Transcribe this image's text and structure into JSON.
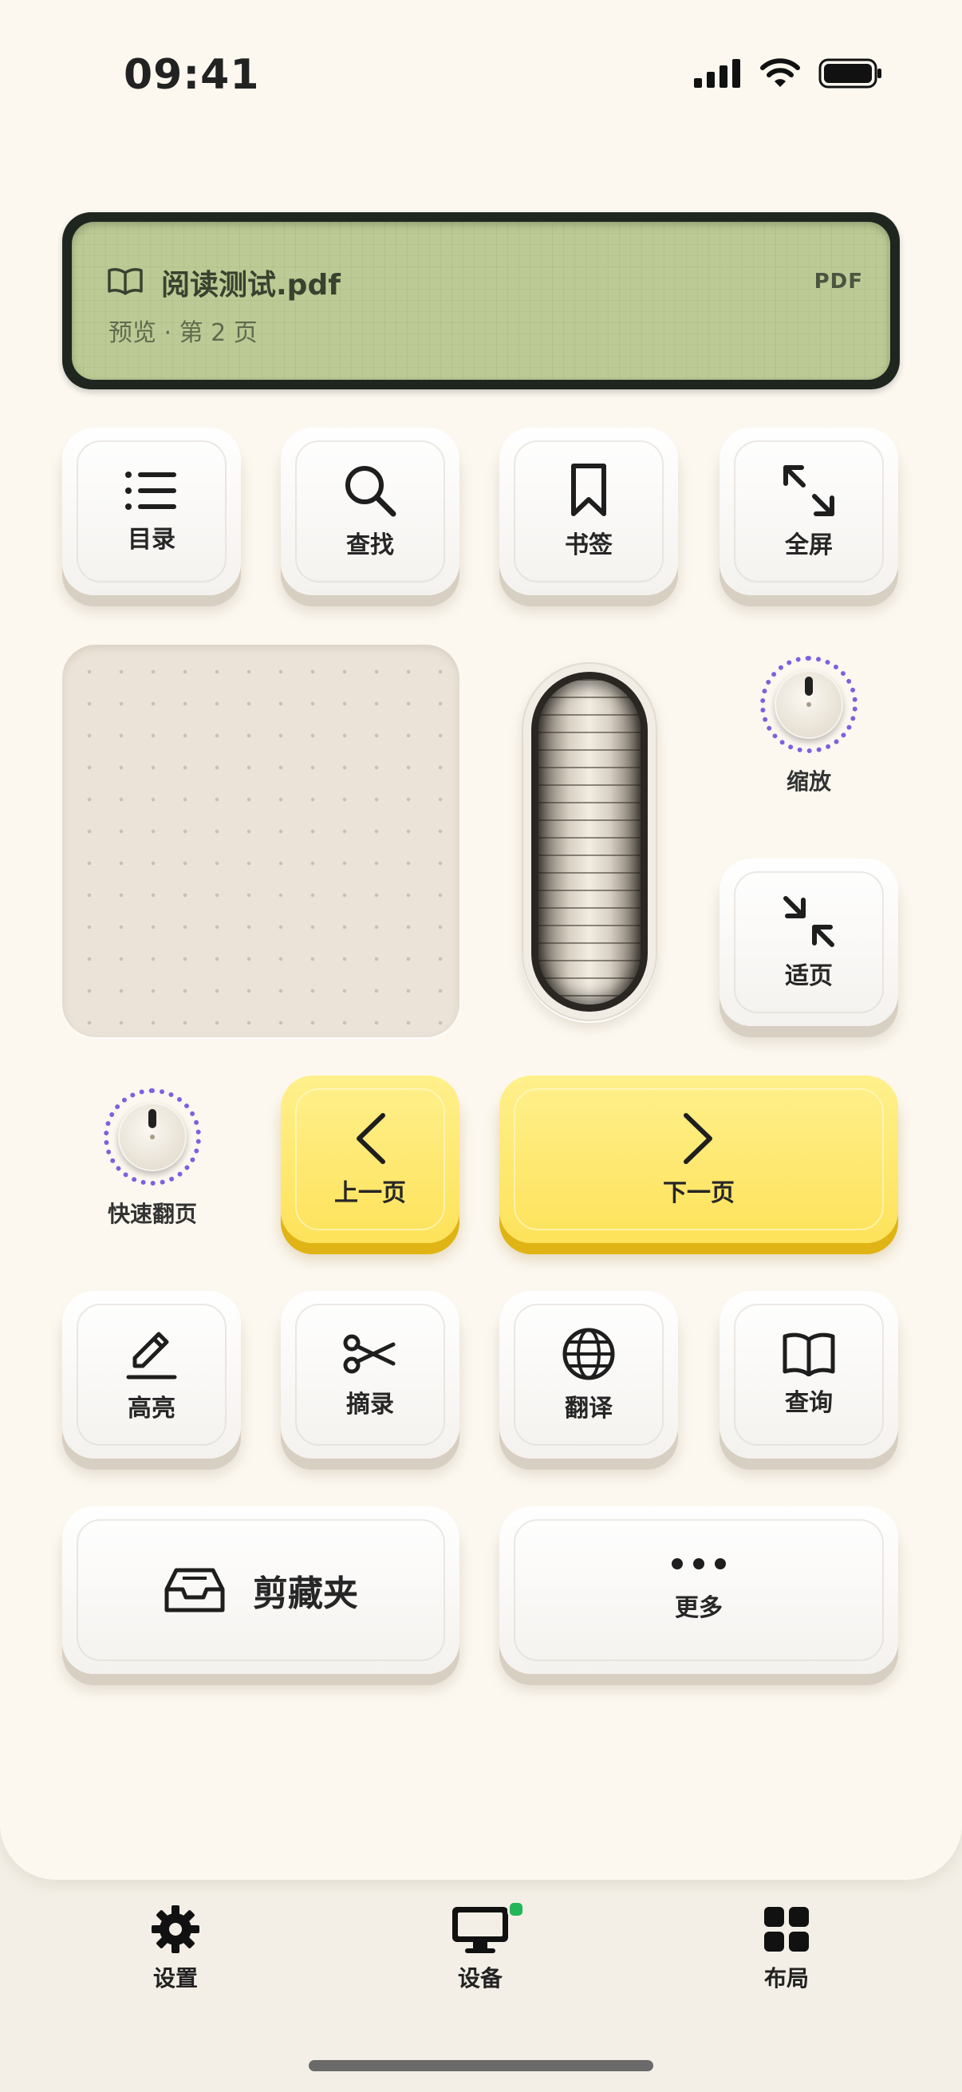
{
  "status": {
    "time": "09:41"
  },
  "display": {
    "title": "阅读测试.pdf",
    "subtitle": "预览 · 第 2 页",
    "badge": "PDF"
  },
  "top_keys": [
    {
      "label": "目录",
      "icon": "list-icon"
    },
    {
      "label": "查找",
      "icon": "search-icon"
    },
    {
      "label": "书签",
      "icon": "bookmark-icon"
    },
    {
      "label": "全屏",
      "icon": "expand-icon"
    }
  ],
  "zoom": {
    "label": "缩放"
  },
  "fit_page": {
    "label": "适页",
    "icon": "shrink-icon"
  },
  "quick_flip": {
    "label": "快速翻页"
  },
  "prev_page": {
    "label": "上一页",
    "icon": "chevron-left-icon"
  },
  "next_page": {
    "label": "下一页",
    "icon": "chevron-right-icon"
  },
  "tool_keys": [
    {
      "label": "高亮",
      "icon": "pencil-icon"
    },
    {
      "label": "摘录",
      "icon": "scissors-icon"
    },
    {
      "label": "翻译",
      "icon": "globe-icon"
    },
    {
      "label": "查询",
      "icon": "open-book-icon"
    }
  ],
  "clip_folder": {
    "label": "剪藏夹",
    "icon": "inbox-icon"
  },
  "more": {
    "label": "更多",
    "icon": "ellipsis-icon"
  },
  "tabbar": [
    {
      "label": "设置",
      "icon": "gear-icon"
    },
    {
      "label": "设备",
      "icon": "monitor-icon"
    },
    {
      "label": "布局",
      "icon": "grid-icon"
    }
  ],
  "colors": {
    "accent_yellow": "#fde25a",
    "knob_ring": "#7b62e0",
    "lcd": "#bccb95",
    "online_dot": "#22b55a"
  }
}
